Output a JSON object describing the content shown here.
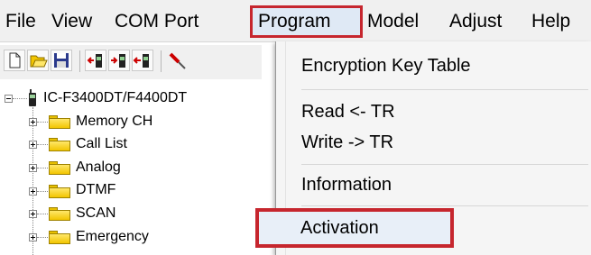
{
  "menubar": {
    "items": [
      {
        "label": "File"
      },
      {
        "label": "View"
      },
      {
        "label": "COM Port"
      },
      {
        "label": "Program"
      },
      {
        "label": "Model"
      },
      {
        "label": "Adjust"
      },
      {
        "label": "Help"
      }
    ]
  },
  "toolbar": {
    "icons": [
      "new-file-icon",
      "open-folder-icon",
      "save-icon",
      "read-radio-icon",
      "write-radio-icon",
      "clone-radio-icon",
      "screwdriver-icon"
    ]
  },
  "tree": {
    "root": {
      "label": "IC-F3400DT/F4400DT",
      "expanded": true
    },
    "children": [
      {
        "label": "Memory CH"
      },
      {
        "label": "Call List"
      },
      {
        "label": "Analog"
      },
      {
        "label": "DTMF"
      },
      {
        "label": "SCAN"
      },
      {
        "label": "Emergency"
      }
    ]
  },
  "program_menu": {
    "items": [
      {
        "label": "Encryption Key Table"
      },
      {
        "label": "Read <- TR"
      },
      {
        "label": "Write -> TR"
      },
      {
        "label": "Information"
      },
      {
        "label": "Activation"
      }
    ]
  },
  "colors": {
    "highlight_border": "#c6262e",
    "menu_bg": "#f5f5f5",
    "folder": "#f2c500"
  }
}
